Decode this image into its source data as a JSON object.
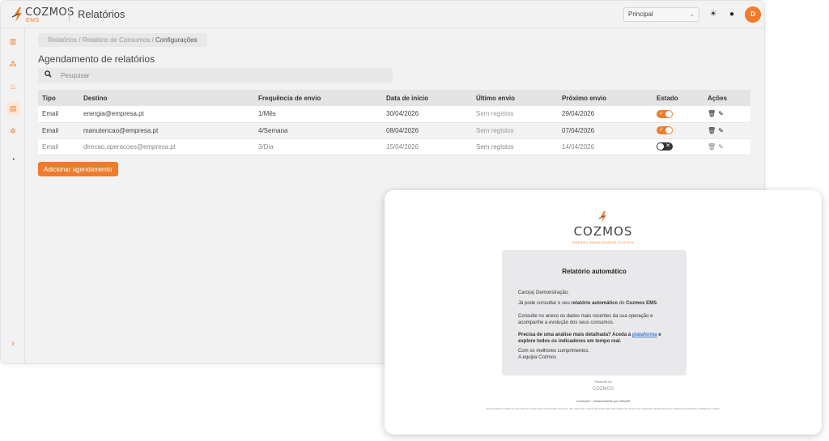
{
  "brand": {
    "name": "COZMOS",
    "sub": "EMS",
    "accent": "#f07b2a"
  },
  "header": {
    "title": "Relatórios",
    "selector_value": "Principal",
    "avatar_initial": "D"
  },
  "sidebar": {
    "icons": [
      "chart-icon",
      "network-icon",
      "flame-icon",
      "document-icon",
      "gear-icon",
      "gauge-icon"
    ],
    "expand_icon": "chevron-right-icon"
  },
  "breadcrumb": {
    "item1": "Relatórios",
    "sep": "/",
    "item2": "Relatório de Consumos",
    "current": "Configurações"
  },
  "page": {
    "title": "Agendamento de relatórios",
    "search_placeholder": "Pesquisar",
    "add_button": "Adicionar agendamento"
  },
  "table": {
    "headers": [
      "Tipo",
      "Destino",
      "Frequência de envio",
      "Data de início",
      "Último envio",
      "Próximo envio",
      "Estado",
      "Ações"
    ],
    "rows": [
      {
        "tipo": "Email",
        "destino": "energia@empresa.pt",
        "freq": "1/Mês",
        "inicio": "30/04/2026",
        "ultimo": "Sem registos",
        "proximo": "29/04/2026",
        "estado": "on"
      },
      {
        "tipo": "Email",
        "destino": "manutencao@empresa.pt",
        "freq": "4/Semana",
        "inicio": "08/04/2026",
        "ultimo": "Sem registos",
        "proximo": "07/04/2026",
        "estado": "on"
      },
      {
        "tipo": "Email",
        "destino": "direcao.operacoes@empresa.pt",
        "freq": "3/Dia",
        "inicio": "15/04/2026",
        "ultimo": "Sem registos",
        "proximo": "14/04/2026",
        "estado": "off"
      }
    ]
  },
  "email": {
    "logo_word": "COZMOS",
    "logo_tag": "ENERGY MANAGEMENT SYSTEM",
    "title": "Relatório automático",
    "greeting": "Caro(a) Demonstração,",
    "line1_pre": "Já pode consultar o seu ",
    "line1_bold": "relatório automático",
    "line1_mid": " do ",
    "line1_bold2": "Cozmos EMS",
    "line1_end": ".",
    "line2": "Consulte no anexo os dados mais recentes da sua operação e acompanhe a evolução dos seus consumos.",
    "line3_pre": "Precisa de uma análise mais detalhada? Aceda à ",
    "line3_link": "plataforma",
    "line3_post": " e explore todos os indicadores em tempo real.",
    "signoff": "Com os melhores cumprimentos,",
    "team": "A equipa Cozmos",
    "footer_powered": "Powered by",
    "footer_logo": "COZMOS",
    "footer_dev": "Cozmos© - Desenvolvido por Zébra®",
    "footer_small": "Este email foi enviado de uma conta de correio não monitorizada. Por favor, não responda a esta email. Para mais informações por favor envie email para info@cozmos.pt | Política de privacidade | Política de cookies"
  }
}
